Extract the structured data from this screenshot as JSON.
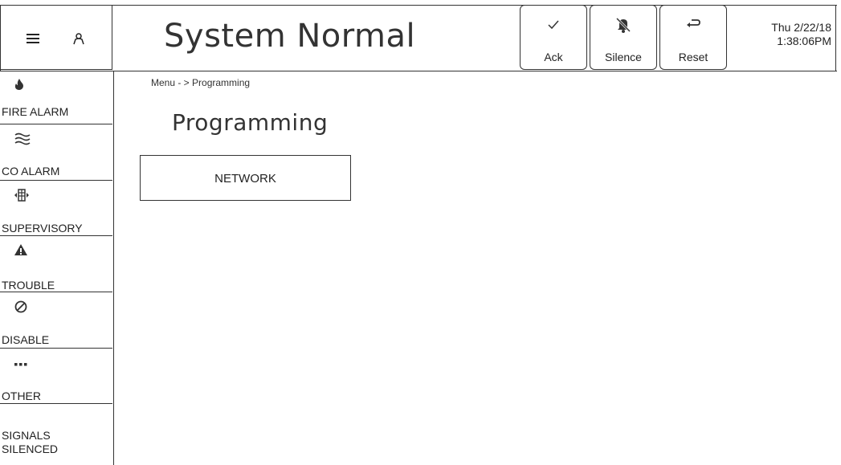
{
  "header": {
    "status_title": "System Normal",
    "buttons": [
      {
        "label": "Ack",
        "icon": "checkmark-icon"
      },
      {
        "label": "Silence",
        "icon": "silenced-bell-icon"
      },
      {
        "label": "Reset",
        "icon": "return-arrow-icon"
      }
    ],
    "date": "Thu 2/22/18",
    "time": "1:38:06PM"
  },
  "sidebar": {
    "items": [
      {
        "label": "FIRE ALARM",
        "icon": "flame-icon"
      },
      {
        "label": "CO ALARM",
        "icon": "waves-icon"
      },
      {
        "label": "SUPERVISORY",
        "icon": "supervisory-icon"
      },
      {
        "label": "TROUBLE",
        "icon": "warning-triangle-icon"
      },
      {
        "label": "DISABLE",
        "icon": "disabled-circle-icon"
      },
      {
        "label": "OTHER",
        "icon": "ellipsis-icon"
      },
      {
        "label_line1": "SIGNALS",
        "label_line2": "SILENCED"
      }
    ]
  },
  "main": {
    "breadcrumb": "Menu - > Programming",
    "title": "Programming",
    "menu_buttons": [
      {
        "label": "NETWORK"
      }
    ]
  }
}
